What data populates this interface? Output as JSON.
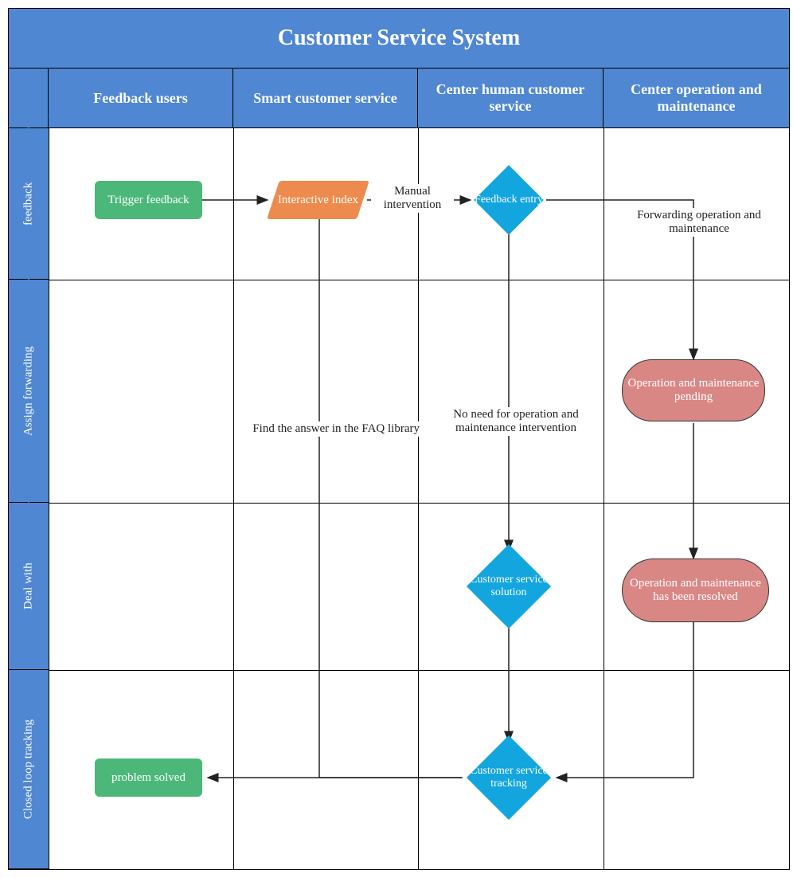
{
  "title": "Customer Service System",
  "columns": [
    "Feedback users",
    "Smart customer service",
    "Center human customer service",
    "Center operation and maintenance"
  ],
  "rows": [
    "feedback",
    "Assign forwarding",
    "Deal with",
    "Closed loop tracking"
  ],
  "nodes": {
    "trigger_feedback": "Trigger feedback",
    "interactive_index": "Interactive index",
    "feedback_entry": "Feedback entry",
    "op_pending": "Operation and maintenance pending",
    "cs_solution": "Customer service solution",
    "op_resolved": "Operation and maintenance has been resolved",
    "cs_tracking": "Customer service tracking",
    "problem_solved": "problem solved"
  },
  "edges": {
    "manual_intervention": "Manual intervention",
    "forwarding_op": "Forwarding operation and maintenance",
    "faq": "Find the answer in the FAQ library",
    "no_op": "No need for operation and maintenance intervention"
  }
}
